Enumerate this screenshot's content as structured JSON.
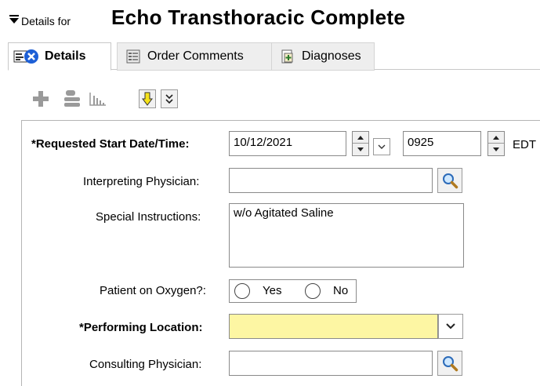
{
  "header": {
    "prefix": "Details for",
    "title": "Echo Transthoracic Complete"
  },
  "tabs": [
    {
      "label": "Details",
      "icon": "details-error-icon",
      "active": true
    },
    {
      "label": "Order Comments",
      "icon": "comments-icon",
      "active": false
    },
    {
      "label": "Diagnoses",
      "icon": "diagnoses-icon",
      "active": false
    }
  ],
  "toolbar": {
    "icons": [
      "add-icon",
      "remove-icon",
      "chart-icon",
      "down-arrow-icon",
      "double-chevron-icon"
    ]
  },
  "form": {
    "start_date": {
      "label": "*Requested Start Date/Time:",
      "date": "10/12/2021",
      "time": "0925",
      "timezone": "EDT"
    },
    "interpreting": {
      "label": "Interpreting Physician:",
      "value": ""
    },
    "special": {
      "label": "Special Instructions:",
      "value": "w/o Agitated Saline"
    },
    "oxygen": {
      "label": "Patient on Oxygen?:",
      "yes": "Yes",
      "no": "No"
    },
    "location": {
      "label": "*Performing Location:",
      "value": "",
      "highlight": "#fdf6a3"
    },
    "consulting": {
      "label": "Consulting Physician:",
      "value": ""
    }
  }
}
